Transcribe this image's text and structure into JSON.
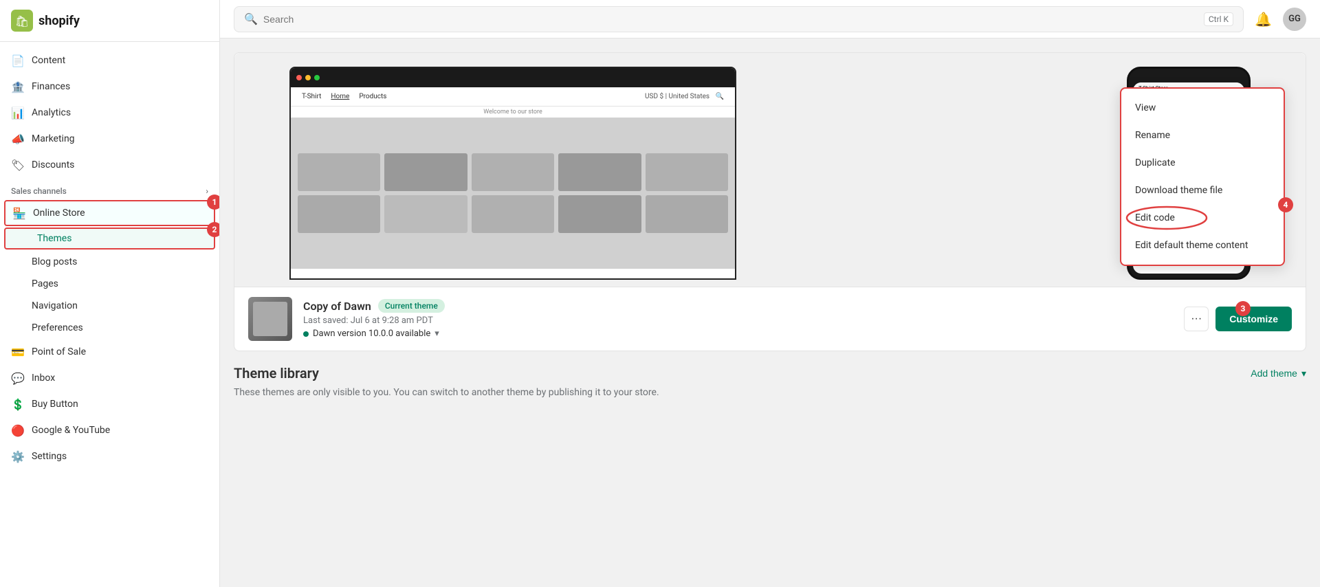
{
  "app": {
    "name": "shopify",
    "logo_text": "shopify"
  },
  "topbar": {
    "search_placeholder": "Search",
    "search_shortcut": "Ctrl K",
    "user_initials": "GG"
  },
  "sidebar": {
    "sections": [
      {
        "type": "item",
        "label": "Content",
        "icon": "📄",
        "active": false
      },
      {
        "type": "item",
        "label": "Finances",
        "icon": "🏦",
        "active": false
      },
      {
        "type": "item",
        "label": "Analytics",
        "icon": "📊",
        "active": false
      },
      {
        "type": "item",
        "label": "Marketing",
        "icon": "📣",
        "active": false
      },
      {
        "type": "item",
        "label": "Discounts",
        "icon": "🏷",
        "active": false
      }
    ],
    "sales_channels_label": "Sales channels",
    "online_store_label": "Online Store",
    "themes_label": "Themes",
    "blog_posts_label": "Blog posts",
    "pages_label": "Pages",
    "navigation_label": "Navigation",
    "preferences_label": "Preferences",
    "point_of_sale_label": "Point of Sale",
    "inbox_label": "Inbox",
    "buy_button_label": "Buy Button",
    "google_youtube_label": "Google & YouTube",
    "settings_label": "Settings"
  },
  "dropdown": {
    "view_label": "View",
    "rename_label": "Rename",
    "duplicate_label": "Duplicate",
    "download_label": "Download theme file",
    "edit_code_label": "Edit code",
    "edit_default_label": "Edit default theme content"
  },
  "theme": {
    "name": "Copy of Dawn",
    "badge": "Current theme",
    "saved": "Last saved: Jul 6 at 9:28 am PDT",
    "version": "Dawn version 10.0.0 available",
    "customize_label": "Customize",
    "more_icon": "···"
  },
  "library": {
    "title": "Theme library",
    "add_label": "Add theme",
    "description": "These themes are only visible to you. You can switch to another theme by publishing it to your store."
  },
  "store_preview": {
    "welcome_text": "Welcome to our store",
    "store_name": "T-Shirt",
    "nav_home": "Home",
    "nav_products": "Products",
    "currency": "USD $ | United States"
  },
  "badges": {
    "b1": "1",
    "b2": "2",
    "b3": "3",
    "b4": "4"
  }
}
